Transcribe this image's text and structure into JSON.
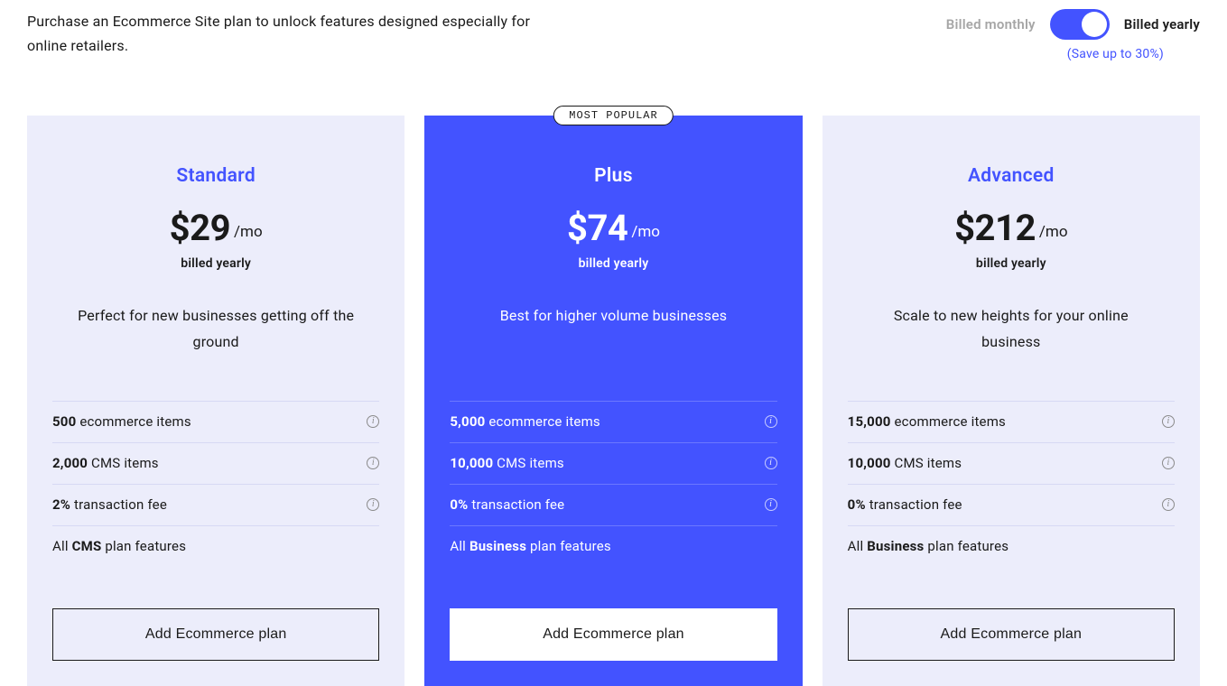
{
  "header": {
    "intro": "Purchase an Ecommerce Site plan to unlock features designed especially for online retailers.",
    "monthly_label": "Billed monthly",
    "yearly_label": "Billed yearly",
    "save_note": "(Save up to 30%)",
    "toggle_state": "yearly"
  },
  "plans": [
    {
      "name": "Standard",
      "price": "$29",
      "period": "/mo",
      "billing": "billed yearly",
      "description": "Perfect for new businesses getting off the ground",
      "features": [
        {
          "bold": "500",
          "rest": "ecommerce items"
        },
        {
          "bold": "2,000",
          "rest": "CMS items"
        },
        {
          "bold": "2%",
          "rest": "transaction fee"
        },
        {
          "pre": "All",
          "bold": "CMS",
          "rest": "plan features"
        }
      ],
      "cta": "Add Ecommerce plan"
    },
    {
      "name": "Plus",
      "badge": "MOST POPULAR",
      "price": "$74",
      "period": "/mo",
      "billing": "billed yearly",
      "description": "Best for higher volume businesses",
      "features": [
        {
          "bold": "5,000",
          "rest": "ecommerce items"
        },
        {
          "bold": "10,000",
          "rest": "CMS items"
        },
        {
          "bold": "0%",
          "rest": "transaction fee"
        },
        {
          "pre": "All",
          "bold": "Business",
          "rest": "plan features"
        }
      ],
      "cta": "Add Ecommerce plan"
    },
    {
      "name": "Advanced",
      "price": "$212",
      "period": "/mo",
      "billing": "billed yearly",
      "description": "Scale to new heights for your online business",
      "features": [
        {
          "bold": "15,000",
          "rest": "ecommerce items"
        },
        {
          "bold": "10,000",
          "rest": "CMS items"
        },
        {
          "bold": "0%",
          "rest": "transaction fee"
        },
        {
          "pre": "All",
          "bold": "Business",
          "rest": "plan features"
        }
      ],
      "cta": "Add Ecommerce plan"
    }
  ]
}
